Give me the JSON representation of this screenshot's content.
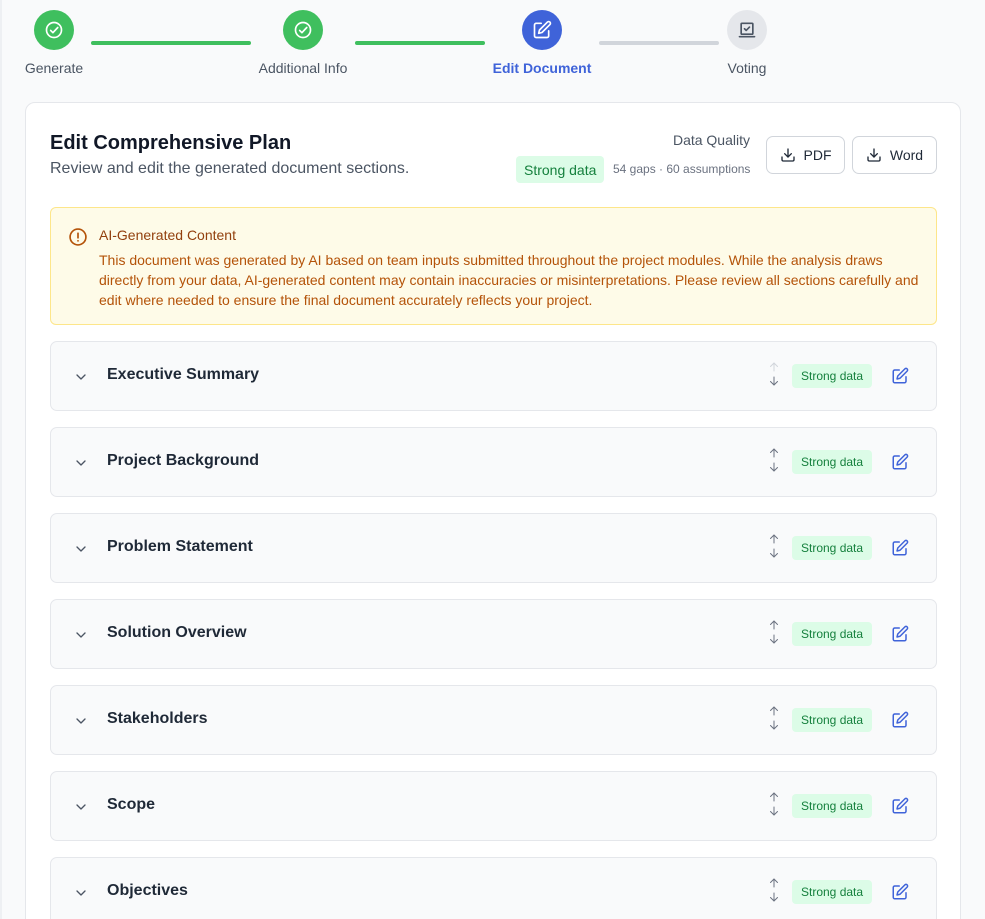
{
  "stepper": {
    "steps": [
      {
        "label": "Generate",
        "state": "done",
        "icon": "check-circle-icon"
      },
      {
        "label": "Additional Info",
        "state": "done",
        "icon": "check-circle-icon"
      },
      {
        "label": "Edit Document",
        "state": "active",
        "icon": "edit-icon"
      },
      {
        "label": "Voting",
        "state": "pending",
        "icon": "vote-icon"
      }
    ]
  },
  "header": {
    "title": "Edit Comprehensive Plan",
    "subtitle": "Review and edit the generated document sections.",
    "data_quality_label": "Data Quality",
    "data_quality_badge": "Strong data",
    "data_quality_stats": "54 gaps · 60 assumptions"
  },
  "toolbar": {
    "pdf_label": "PDF",
    "word_label": "Word"
  },
  "alert": {
    "title": "AI-Generated Content",
    "body": "This document was generated by AI based on team inputs submitted throughout the project modules. While the analysis draws directly from your data, AI-generated content may contain inaccuracies or misinterpretations. Please review all sections carefully and edit where needed to ensure the final document accurately reflects your project."
  },
  "sections": [
    {
      "title": "Executive Summary",
      "badge": "Strong data"
    },
    {
      "title": "Project Background",
      "badge": "Strong data"
    },
    {
      "title": "Problem Statement",
      "badge": "Strong data"
    },
    {
      "title": "Solution Overview",
      "badge": "Strong data"
    },
    {
      "title": "Stakeholders",
      "badge": "Strong data"
    },
    {
      "title": "Scope",
      "badge": "Strong data"
    },
    {
      "title": "Objectives",
      "badge": "Strong data"
    }
  ],
  "colors": {
    "done": "#3fbf5e",
    "active": "#3f63d9",
    "pending": "#e5e7eb",
    "badge_bg": "#dcfce7",
    "badge_text": "#15803d",
    "alert_bg": "#fefbe8"
  }
}
